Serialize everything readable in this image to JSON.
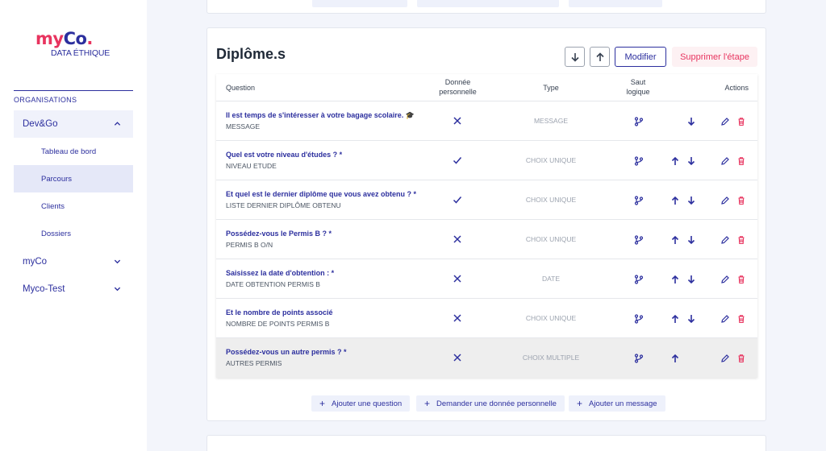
{
  "logo": {
    "my": "my",
    "co": "Co",
    "dot": ".",
    "subtitle": "DATA ÉTHIQUE"
  },
  "sidebar": {
    "section_title": "ORGANISATIONS",
    "orgs": [
      {
        "label": "Dev&Go",
        "expanded": true
      },
      {
        "label": "myCo",
        "expanded": false
      },
      {
        "label": "Myco-Test",
        "expanded": false
      }
    ],
    "subitems": [
      {
        "label": "Tableau de bord"
      },
      {
        "label": "Parcours",
        "active": true
      },
      {
        "label": "Clients"
      },
      {
        "label": "Dossiers"
      }
    ]
  },
  "step": {
    "title": "Diplôme.s",
    "modify_label": "Modifier",
    "delete_label": "Supprimer l'étape"
  },
  "table": {
    "headers": {
      "question": "Question",
      "personal_line1": "Donnée",
      "personal_line2": "personnelle",
      "type": "Type",
      "logic_line1": "Saut",
      "logic_line2": "logique",
      "actions": "Actions"
    },
    "rows": [
      {
        "title": "Il est temps de s'intéresser à votre bagage scolaire. 🎓",
        "code": "MESSAGE",
        "personal": false,
        "type": "MESSAGE",
        "up": false,
        "down": true
      },
      {
        "title": "Quel est votre niveau d'études ? *",
        "code": "NIVEAU ETUDE",
        "personal": true,
        "type": "CHOIX UNIQUE",
        "up": true,
        "down": true
      },
      {
        "title": "Et quel est le dernier diplôme que vous avez obtenu ? *",
        "code": "LISTE DERNIER DIPLÔME OBTENU",
        "personal": true,
        "type": "CHOIX UNIQUE",
        "up": true,
        "down": true
      },
      {
        "title": "Possédez-vous le Permis B ? *",
        "code": "PERMIS B O/N",
        "personal": false,
        "type": "CHOIX UNIQUE",
        "up": true,
        "down": true
      },
      {
        "title": "Saisissez la date d'obtention : *",
        "code": "DATE OBTENTION PERMIS B",
        "personal": false,
        "type": "DATE",
        "up": true,
        "down": true
      },
      {
        "title": "Et le nombre de points associé",
        "code": "NOMBRE DE POINTS PERMIS B",
        "personal": false,
        "type": "CHOIX UNIQUE",
        "up": true,
        "down": true
      },
      {
        "title": "Possédez-vous un autre permis ? *",
        "code": "AUTRES PERMIS",
        "personal": false,
        "type": "CHOIX MULTIPLE",
        "up": true,
        "down": false,
        "highlighted": true
      }
    ]
  },
  "footer_buttons": {
    "add_question": "Ajouter une question",
    "ask_personal": "Demander une donnée personnelle",
    "add_message": "Ajouter un message",
    "plus": "+"
  },
  "colors": {
    "primary": "#2c2f9e",
    "danger": "#e8345f",
    "muted": "#9ca3af"
  }
}
